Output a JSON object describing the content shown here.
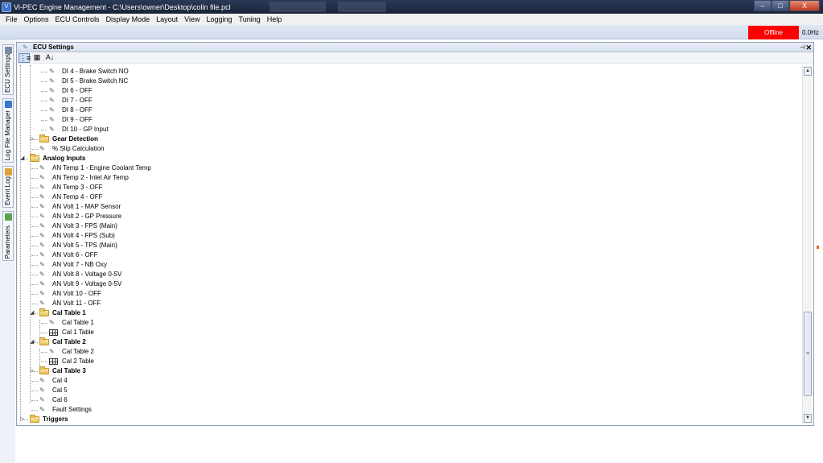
{
  "window": {
    "title": "Vi-PEC Engine Management - C:\\Users\\owner\\Desktop\\colin file.pcl",
    "icon": "app-icon",
    "buttons": {
      "minimize": "–",
      "maximize": "□",
      "close": "X"
    }
  },
  "menu": [
    "File",
    "Options",
    "ECU Controls",
    "Display Mode",
    "Layout",
    "View",
    "Logging",
    "Tuning",
    "Help"
  ],
  "status": {
    "connection": "Offline",
    "connection_color": "#ff0000",
    "frequency": "0.0Hz"
  },
  "side_tabs": [
    {
      "label": "ECU Settings",
      "icon": "wrench-icon"
    },
    {
      "label": "Log File Manager",
      "icon": "log-file-icon"
    },
    {
      "label": "Event Log",
      "icon": "event-log-icon"
    },
    {
      "label": "Parameters",
      "icon": "parameters-icon"
    }
  ],
  "panel": {
    "title": "ECU Settings",
    "pin": "⊣",
    "close": "✕"
  },
  "panel_toolbar": {
    "categorized": "⋮≡",
    "table": "▦",
    "sort": "A↓"
  },
  "tree": [
    {
      "label": "DI  4 - Brake Switch NO",
      "type": "item"
    },
    {
      "label": "DI  5 - Brake Switch NC",
      "type": "item"
    },
    {
      "label": "DI  6 - OFF",
      "type": "item"
    },
    {
      "label": "DI  7 - OFF",
      "type": "item"
    },
    {
      "label": "DI  8 - OFF",
      "type": "item"
    },
    {
      "label": "DI  9 - OFF",
      "type": "item"
    },
    {
      "label": "DI 10 - GP Input",
      "type": "item"
    },
    {
      "label": "Gear Detection",
      "type": "folder-collapsed"
    },
    {
      "label": "% Slip Calculation",
      "type": "item"
    },
    {
      "label": "Analog Inputs",
      "type": "folder-expanded"
    },
    {
      "label": "AN Temp 1 - Engine Coolant Temp",
      "type": "item"
    },
    {
      "label": "AN Temp 2 - Inlet Air Temp",
      "type": "item"
    },
    {
      "label": "AN Temp 3 - OFF",
      "type": "item"
    },
    {
      "label": "AN Temp 4 - OFF",
      "type": "item"
    },
    {
      "label": "AN Volt 1 - MAP Sensor",
      "type": "item"
    },
    {
      "label": "AN Volt 2 - GP Pressure",
      "type": "item"
    },
    {
      "label": "AN Volt 3 - FPS (Main)",
      "type": "item"
    },
    {
      "label": "AN Volt 4 - FPS (Sub)",
      "type": "item"
    },
    {
      "label": "AN Volt 5 - TPS (Main)",
      "type": "item"
    },
    {
      "label": "AN Volt 6 - OFF",
      "type": "item"
    },
    {
      "label": "AN Volt 7 - NB Oxy",
      "type": "item"
    },
    {
      "label": "AN Volt 8 - Voltage 0-5V",
      "type": "item"
    },
    {
      "label": "AN Volt 9 - Voltage 0-5V",
      "type": "item"
    },
    {
      "label": "AN Volt 10 - OFF",
      "type": "item"
    },
    {
      "label": "AN Volt 11 - OFF",
      "type": "item"
    },
    {
      "label": "Cal Table 1",
      "type": "folder-expanded"
    },
    {
      "label": "Cal Table 1",
      "type": "item"
    },
    {
      "label": "Cal 1 Table",
      "type": "table"
    },
    {
      "label": "Cal Table 2",
      "type": "folder-expanded"
    },
    {
      "label": "Cal Table 2",
      "type": "item"
    },
    {
      "label": "Cal 2 Table",
      "type": "table"
    },
    {
      "label": "Cal Table 3",
      "type": "folder-collapsed"
    },
    {
      "label": "Cal 4",
      "type": "item"
    },
    {
      "label": "Cal 5",
      "type": "item"
    },
    {
      "label": "Cal 6",
      "type": "item"
    },
    {
      "label": "Fault Settings",
      "type": "item"
    },
    {
      "label": "Triggers",
      "type": "folder-collapsed"
    }
  ]
}
